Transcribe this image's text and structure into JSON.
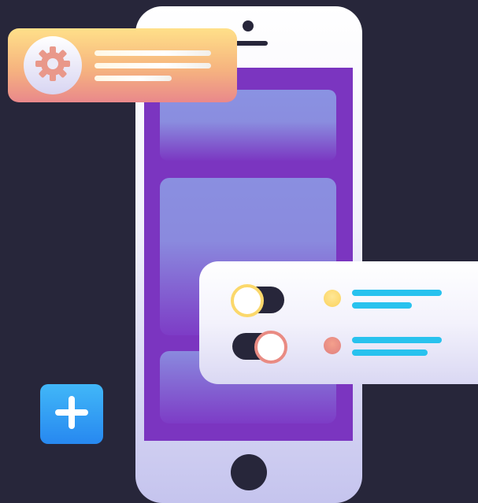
{
  "colors": {
    "background": "#27263a",
    "phone_screen": "#7b35c0",
    "notification_gradient_top": "#ffe089",
    "notification_gradient_bottom": "#e9888b",
    "gear": "#e9988a",
    "toggle_yellow": "#fbd86b",
    "toggle_coral": "#e98b83",
    "text_bar_cyan": "#28c2ee",
    "plus_button": "#2f95f3"
  },
  "icons": {
    "notification": "gear-icon",
    "add": "plus-icon"
  },
  "toggles": [
    {
      "state": "off",
      "accent": "#fbd86b"
    },
    {
      "state": "on",
      "accent": "#e98b83"
    }
  ]
}
